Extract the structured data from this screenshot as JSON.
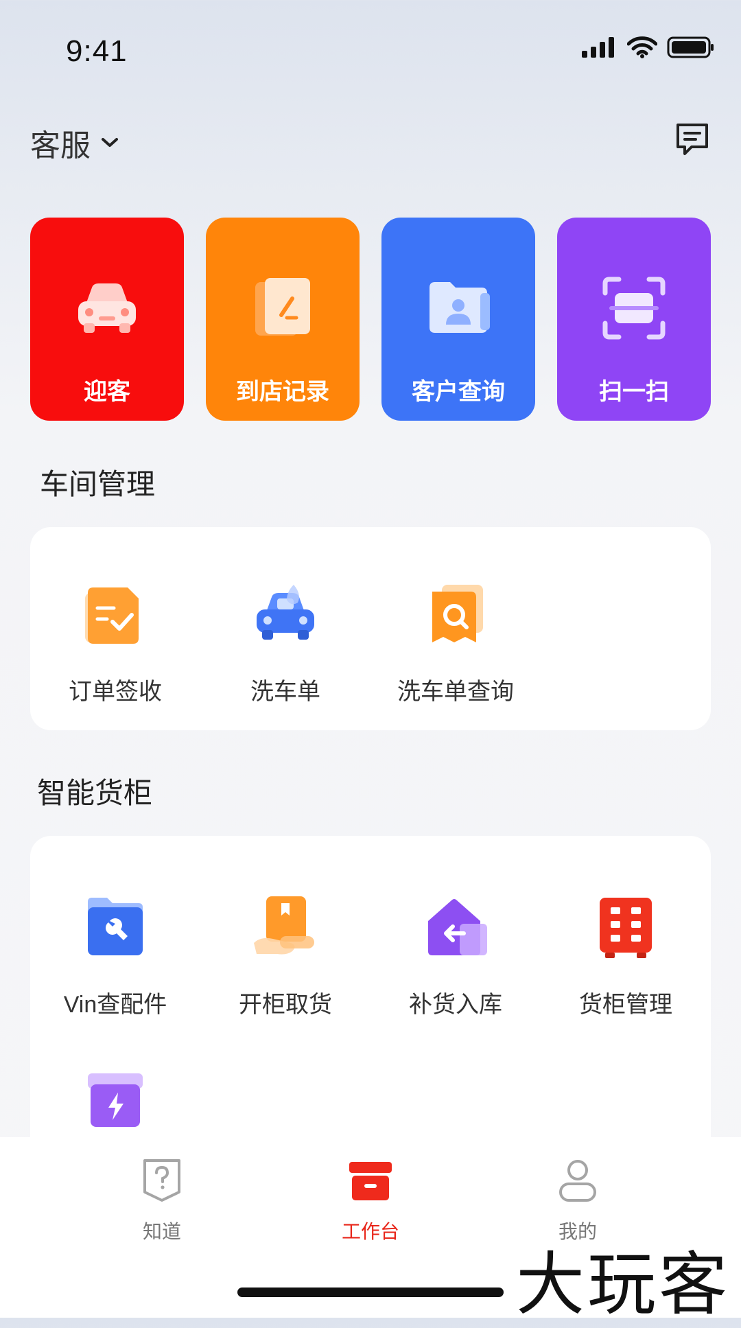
{
  "status_bar": {
    "time": "9:41"
  },
  "header": {
    "role": "客服",
    "message_icon": "message-icon"
  },
  "quick_actions": [
    {
      "label": "迎客",
      "icon": "car-icon",
      "color": "#f80d0d"
    },
    {
      "label": "到店记录",
      "icon": "edit-note-icon",
      "color": "#ff850a"
    },
    {
      "label": "客户查询",
      "icon": "folder-user-icon",
      "color": "#3d74f7"
    },
    {
      "label": "扫一扫",
      "icon": "scan-icon",
      "color": "#8f45f5"
    }
  ],
  "workshop": {
    "title": "车间管理",
    "items": [
      {
        "label": "订单签收",
        "icon": "order-check-icon"
      },
      {
        "label": "洗车单",
        "icon": "car-wash-icon"
      },
      {
        "label": "洗车单查询",
        "icon": "doc-search-icon"
      }
    ]
  },
  "cabinet": {
    "title": "智能货柜",
    "items": [
      {
        "label": "Vin查配件",
        "icon": "wrench-folder-icon"
      },
      {
        "label": "开柜取货",
        "icon": "pickup-icon"
      },
      {
        "label": "补货入库",
        "icon": "restock-icon"
      },
      {
        "label": "货柜管理",
        "icon": "cabinet-grid-icon"
      },
      {
        "label": "",
        "icon": "power-box-icon"
      }
    ]
  },
  "tabbar": [
    {
      "label": "知道",
      "icon": "question-doc-icon",
      "active": false
    },
    {
      "label": "工作台",
      "icon": "workbench-icon",
      "active": true
    },
    {
      "label": "我的",
      "icon": "user-icon",
      "active": false
    }
  ],
  "watermark": "大玩客"
}
